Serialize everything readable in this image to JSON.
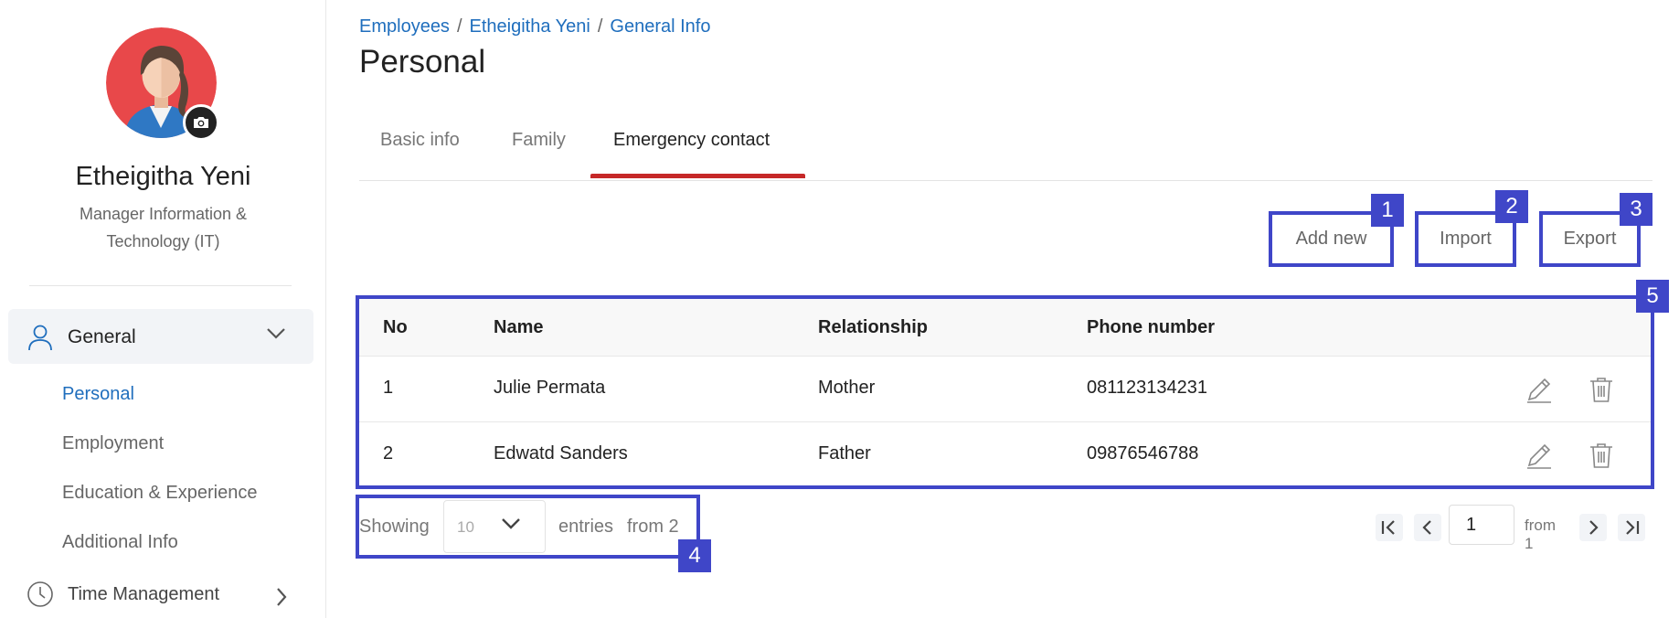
{
  "sidebar": {
    "user_name": "Etheigitha Yeni",
    "user_role": "Manager Information & Technology (IT)",
    "general_label": "General",
    "submenu": [
      "Personal",
      "Employment",
      "Education & Experience",
      "Additional Info"
    ],
    "time_label": "Time Management"
  },
  "breadcrumb": [
    "Employees",
    "Etheigitha Yeni",
    "General Info"
  ],
  "page_title": "Personal",
  "tabs": [
    "Basic info",
    "Family",
    "Emergency contact"
  ],
  "actions": {
    "add_new": "Add new",
    "import": "Import",
    "export": "Export"
  },
  "table": {
    "headers": [
      "No",
      "Name",
      "Relationship",
      "Phone number"
    ],
    "rows": [
      {
        "no": "1",
        "name": "Julie Permata",
        "relationship": "Mother",
        "phone": "081123134231"
      },
      {
        "no": "2",
        "name": "Edwatd Sanders",
        "relationship": "Father",
        "phone": "09876546788"
      }
    ]
  },
  "footer": {
    "showing": "Showing",
    "page_size": "10",
    "entries": "entries",
    "from_total": "from 2",
    "page_value": "1",
    "from_pages": "from 1"
  },
  "annotations": [
    "1",
    "2",
    "3",
    "4",
    "5"
  ],
  "colors": {
    "accent_link": "#1f6ebd",
    "tab_indicator": "#c62828",
    "annotation": "#3f46c8"
  }
}
